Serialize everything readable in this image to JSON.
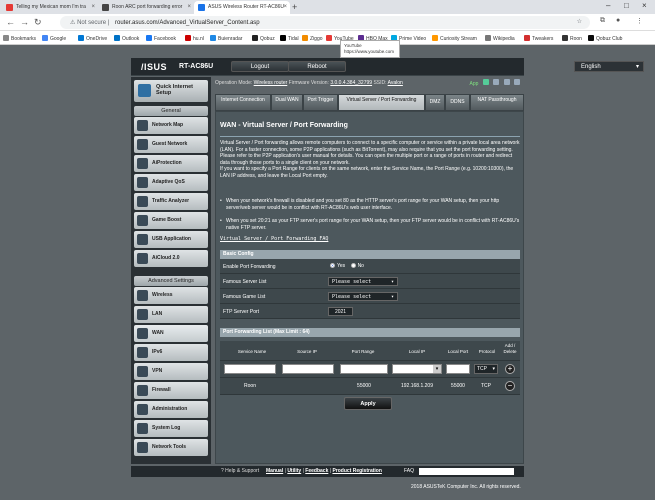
{
  "browser": {
    "tabs": [
      {
        "label": "Telling my Mexican mom I'm tra",
        "fav_color": "#e53935",
        "active": false
      },
      {
        "label": "Roon ARC port forwarding error",
        "fav_color": "#444444",
        "active": false
      },
      {
        "label": "ASUS Wireless Router RT-AC86U",
        "fav_color": "#1a73e8",
        "active": true
      }
    ],
    "not_secure": "Not secure",
    "url": "router.asus.com/Advanced_VirtualServer_Content.asp",
    "bookmarks": [
      "Bookmarks",
      "Google",
      "OneDrive",
      "Outlook",
      "Facebook",
      "hu.nl",
      "Buienradar",
      "Qobuz",
      "Tidal",
      "Ziggo",
      "YouTube",
      "HBO Max",
      "Prime Video",
      "Curiosity Stream",
      "Wikipedia",
      "Tweakers",
      "Roon",
      "Qobuz Club"
    ],
    "tooltip_title": "YouTube",
    "tooltip_url": "https://www.youtube.com"
  },
  "header": {
    "logo": "/ISUS",
    "model": "RT-AC86U",
    "logout": "Logout",
    "reboot": "Reboot",
    "language": "English"
  },
  "status": {
    "op_mode_label": "Operation Mode:",
    "op_mode": "Wireless router",
    "fw_label": "Firmware Version:",
    "fw": "3.0.0.4.384_32799",
    "ssid_label": "SSID:",
    "ssid": "Avalon",
    "app_label": "App"
  },
  "sidebar": {
    "quick": "Quick Internet Setup",
    "general_title": "General",
    "general": [
      "Network Map",
      "Guest Network",
      "AiProtection",
      "Adaptive QoS",
      "Traffic Analyzer",
      "Game Boost",
      "USB Application",
      "AiCloud 2.0"
    ],
    "advanced_title": "Advanced Settings",
    "advanced": [
      "Wireless",
      "LAN",
      "WAN",
      "IPv6",
      "VPN",
      "Firewall",
      "Administration",
      "System Log",
      "Network Tools"
    ]
  },
  "tabs": [
    "Internet Connection",
    "Dual WAN",
    "Port Trigger",
    "Virtual Server / Port Forwarding",
    "DMZ",
    "DDNS",
    "NAT Passthrough"
  ],
  "page": {
    "title": "WAN - Virtual Server / Port Forwarding",
    "desc1": "Virtual Server / Port forwarding allows remote computers to connect to a specific computer or service within a private local area network (LAN). For a faster connection, some P2P applications (such as BitTorrent), may also require that you set the port forwarding setting. Please refer to the P2P application's user manual for details. You can open the multiple port or a range of ports in router and redirect data through those ports to a single client on your network.",
    "desc2": "If you want to specify a Port Range for clients on the same network, enter the Service Name, the Port Range (e.g. 10200:10300), the LAN IP address, and leave the Local Port empty.",
    "bullet1": "When your network's firewall is disabled and you set 80 as the HTTP server's port range for your WAN setup, then your http server/web server would be in conflict with RT-AC86U's web user interface.",
    "bullet2": "When you set 20:21 as your FTP server's port range for your WAN setup, then your FTP server would be in conflict with RT-AC86U's native FTP server.",
    "faq": "Virtual Server / Port Forwarding FAQ"
  },
  "basic": {
    "title": "Basic Config",
    "enable_label": "Enable Port Forwarding",
    "yes": "Yes",
    "no": "No",
    "famous_server_label": "Famous Server List",
    "famous_server_value": "Please select",
    "famous_game_label": "Famous Game List",
    "famous_game_value": "Please select",
    "ftp_label": "FTP Server Port",
    "ftp_value": "2021"
  },
  "list": {
    "title": "Port Forwarding List (Max Limit : 64)",
    "headers": [
      "Service Name",
      "Source IP",
      "Port Range",
      "Local IP",
      "Local Port",
      "Protocol",
      "Add / Delete"
    ],
    "new_protocol": "TCP",
    "row": {
      "service": "Roon",
      "source": "",
      "port_range": "55000",
      "local_ip": "192.168.1.209",
      "local_port": "55000",
      "protocol": "TCP"
    }
  },
  "apply": "Apply",
  "footer": {
    "help": "Help & Support",
    "manual": "Manual",
    "utility": "Utility",
    "feedback": "Feedback",
    "product_registration": "Product Registration",
    "faq": "FAQ",
    "copyright": "2018 ASUSTeK Computer Inc. All rights reserved."
  }
}
